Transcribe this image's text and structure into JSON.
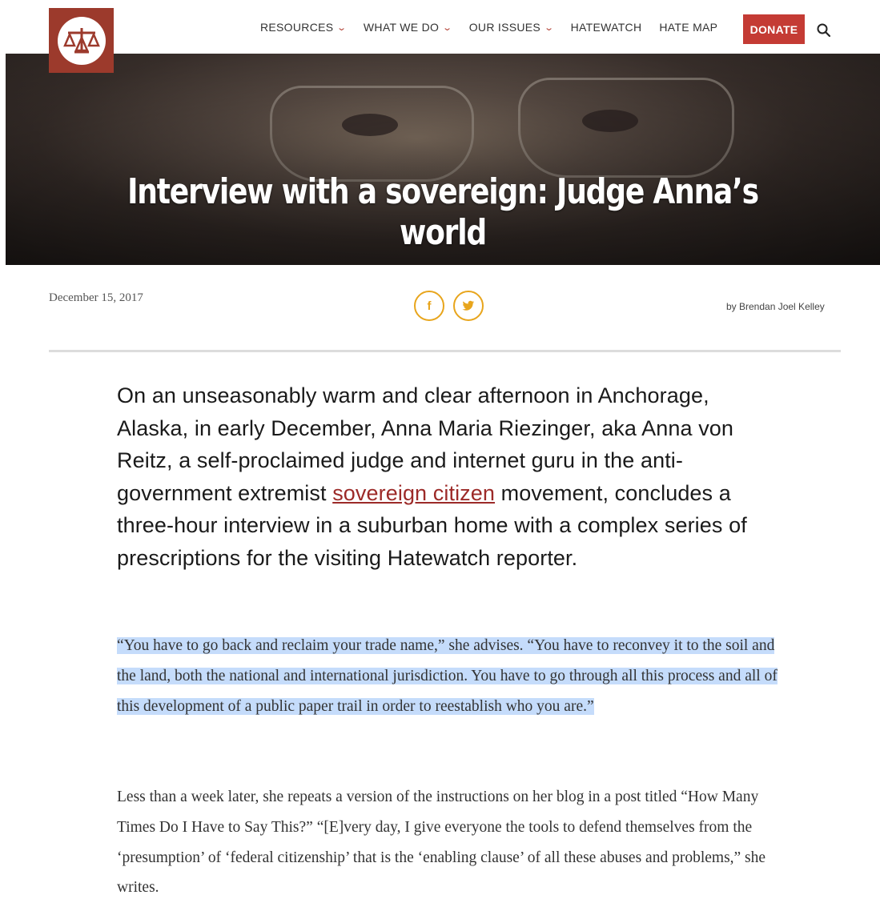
{
  "nav": {
    "items": [
      {
        "label": "RESOURCES",
        "dropdown": true
      },
      {
        "label": "WHAT WE DO",
        "dropdown": true
      },
      {
        "label": "OUR ISSUES",
        "dropdown": true
      },
      {
        "label": "HATEWATCH",
        "dropdown": false
      },
      {
        "label": "HATE MAP",
        "dropdown": false
      }
    ],
    "donate_label": "DONATE"
  },
  "hero": {
    "title": "Interview with a sovereign: Judge Anna’s world"
  },
  "article": {
    "date": "December 15, 2017",
    "byline": "by Brendan Joel Kelley",
    "share": {
      "facebook": "f",
      "twitter": "t"
    },
    "lede_before": "On an unseasonably warm and clear afternoon in Anchorage, Alaska, in early December, Anna Maria Riezinger, aka Anna von Reitz, a self-proclaimed judge and internet guru in the anti-government extremist ",
    "lede_link": "sovereign citizen",
    "lede_after": " movement, concludes a three-hour interview in a suburban home with a complex series of prescriptions for the visiting Hatewatch reporter.",
    "quote": "“You have to go back and reclaim your trade name,” she advises. “You have to reconvey it to the soil and the land, both the national and international jurisdiction. You have to go through all this process and all of this development of a public paper trail in order to reestablish who you are.”",
    "paragraph": "Less than a week later, she repeats a version of the instructions on her blog in a post titled “How Many Times Do I Have to Say This?” “[E]very day, I give everyone the tools to defend themselves from the ‘presumption’ of ‘federal citizenship’ that is the ‘enabling clause’ of all these abuses and problems,” she writes."
  },
  "colors": {
    "brand": "#9c3a2c",
    "donate": "#c43b34",
    "share_accent": "#e8a51c",
    "link": "#9c2a28",
    "highlight": "#c5dcfb"
  },
  "icons": [
    "scales-of-justice-icon",
    "chevron-down-icon",
    "search-icon",
    "facebook-icon",
    "twitter-icon"
  ]
}
